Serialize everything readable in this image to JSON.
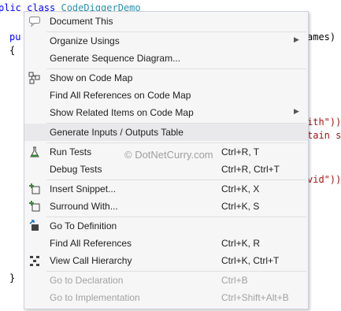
{
  "editor": {
    "lines": {
      "l1_kw": "plic class",
      "l1_type": "CodeDiggerDemo",
      "l2_kw": "pu",
      "l2_tail": "ames)",
      "l3": "{",
      "l4": "ith\"));",
      "l5": "tain s",
      "l6": "vid\"));",
      "l7": "}"
    }
  },
  "menu": {
    "items": [
      {
        "label": "Document This",
        "icon": "comment-icon"
      },
      {
        "label": "Organize Usings",
        "submenu": "▶"
      },
      {
        "label": "Generate Sequence Diagram..."
      },
      {
        "label": "Show on Code Map",
        "icon": "code-map-icon"
      },
      {
        "label": "Find All References on Code Map"
      },
      {
        "label": "Show Related Items on Code Map",
        "submenu": "▶"
      },
      {
        "label": "Generate Inputs / Outputs Table"
      },
      {
        "label": "Run Tests",
        "shortcut": "Ctrl+R, T",
        "icon": "flask-icon"
      },
      {
        "label": "Debug Tests",
        "shortcut": "Ctrl+R, Ctrl+T"
      },
      {
        "label": "Insert Snippet...",
        "shortcut": "Ctrl+K, X",
        "icon": "snippet-icon"
      },
      {
        "label": "Surround With...",
        "shortcut": "Ctrl+K, S",
        "icon": "surround-icon"
      },
      {
        "label": "Go To Definition",
        "icon": "go-definition-icon"
      },
      {
        "label": "Find All References",
        "shortcut": "Ctrl+K, R"
      },
      {
        "label": "View Call Hierarchy",
        "shortcut": "Ctrl+K, Ctrl+T",
        "icon": "call-hierarchy-icon"
      },
      {
        "label": "Go to Declaration",
        "shortcut": "Ctrl+B",
        "disabled": true
      },
      {
        "label": "Go to Implementation",
        "shortcut": "Ctrl+Shift+Alt+B",
        "disabled": true
      }
    ]
  },
  "watermark": "© DotNetCurry.com",
  "colors": {
    "menu_bg": "#f6f6f6",
    "hover_bg": "#e9e9eb",
    "keyword": "#0000ff",
    "type": "#2b91af",
    "string": "#a31515",
    "disabled_text": "#a2a2a2"
  }
}
